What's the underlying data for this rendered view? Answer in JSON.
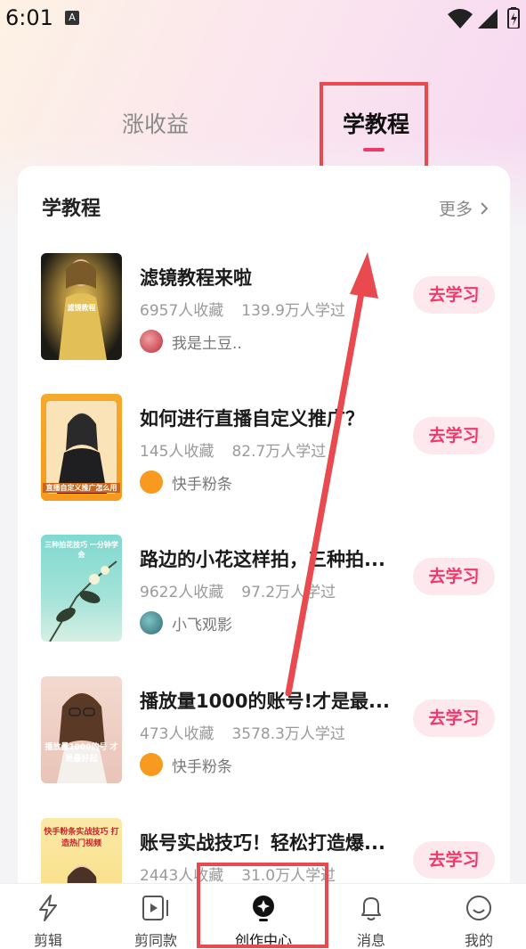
{
  "status_bar": {
    "time": "6:01",
    "notif_icon": "A"
  },
  "tabs": [
    {
      "label": "涨收益",
      "active": false
    },
    {
      "label": "学教程",
      "active": true
    }
  ],
  "section": {
    "title": "学教程",
    "more": "更多"
  },
  "items": [
    {
      "title": "滤镜教程来啦",
      "favorites": "6957人收藏",
      "learners": "139.9万人学过",
      "author": "我是土豆..",
      "button": "去学习",
      "thumb_text": "滤镜教程"
    },
    {
      "title": "如何进行直播自定义推广？",
      "favorites": "145人收藏",
      "learners": "82.7万人学过",
      "author": "快手粉条",
      "button": "去学习",
      "thumb_text": "直播自定义推广怎么用"
    },
    {
      "title": "路边的小花这样拍，三种拍...",
      "favorites": "9622人收藏",
      "learners": "97.2万人学过",
      "author": "小飞观影",
      "button": "去学习",
      "thumb_text": "三种拍花技巧 一分钟学会"
    },
    {
      "title": "播放量1000的账号!才是最...",
      "favorites": "473人收藏",
      "learners": "3578.3万人学过",
      "author": "快手粉条",
      "button": "去学习",
      "thumb_text": "播放量1000的号 才是最好起"
    },
    {
      "title": "账号实战技巧！轻松打造爆...",
      "favorites": "2443人收藏",
      "learners": "31.0万人学过",
      "author": "",
      "button": "去学习",
      "thumb_text": "快手粉条实战技巧 打造热门视频"
    }
  ],
  "bottom_nav": [
    {
      "label": "剪辑",
      "icon": "lightning-icon"
    },
    {
      "label": "剪同款",
      "icon": "play-template-icon"
    },
    {
      "label": "创作中心",
      "icon": "creation-bulb-icon",
      "active": true
    },
    {
      "label": "消息",
      "icon": "bell-icon"
    },
    {
      "label": "我的",
      "icon": "smiley-icon"
    }
  ],
  "colors": {
    "accent": "#f0386b",
    "highlight": "#e84a4f"
  }
}
